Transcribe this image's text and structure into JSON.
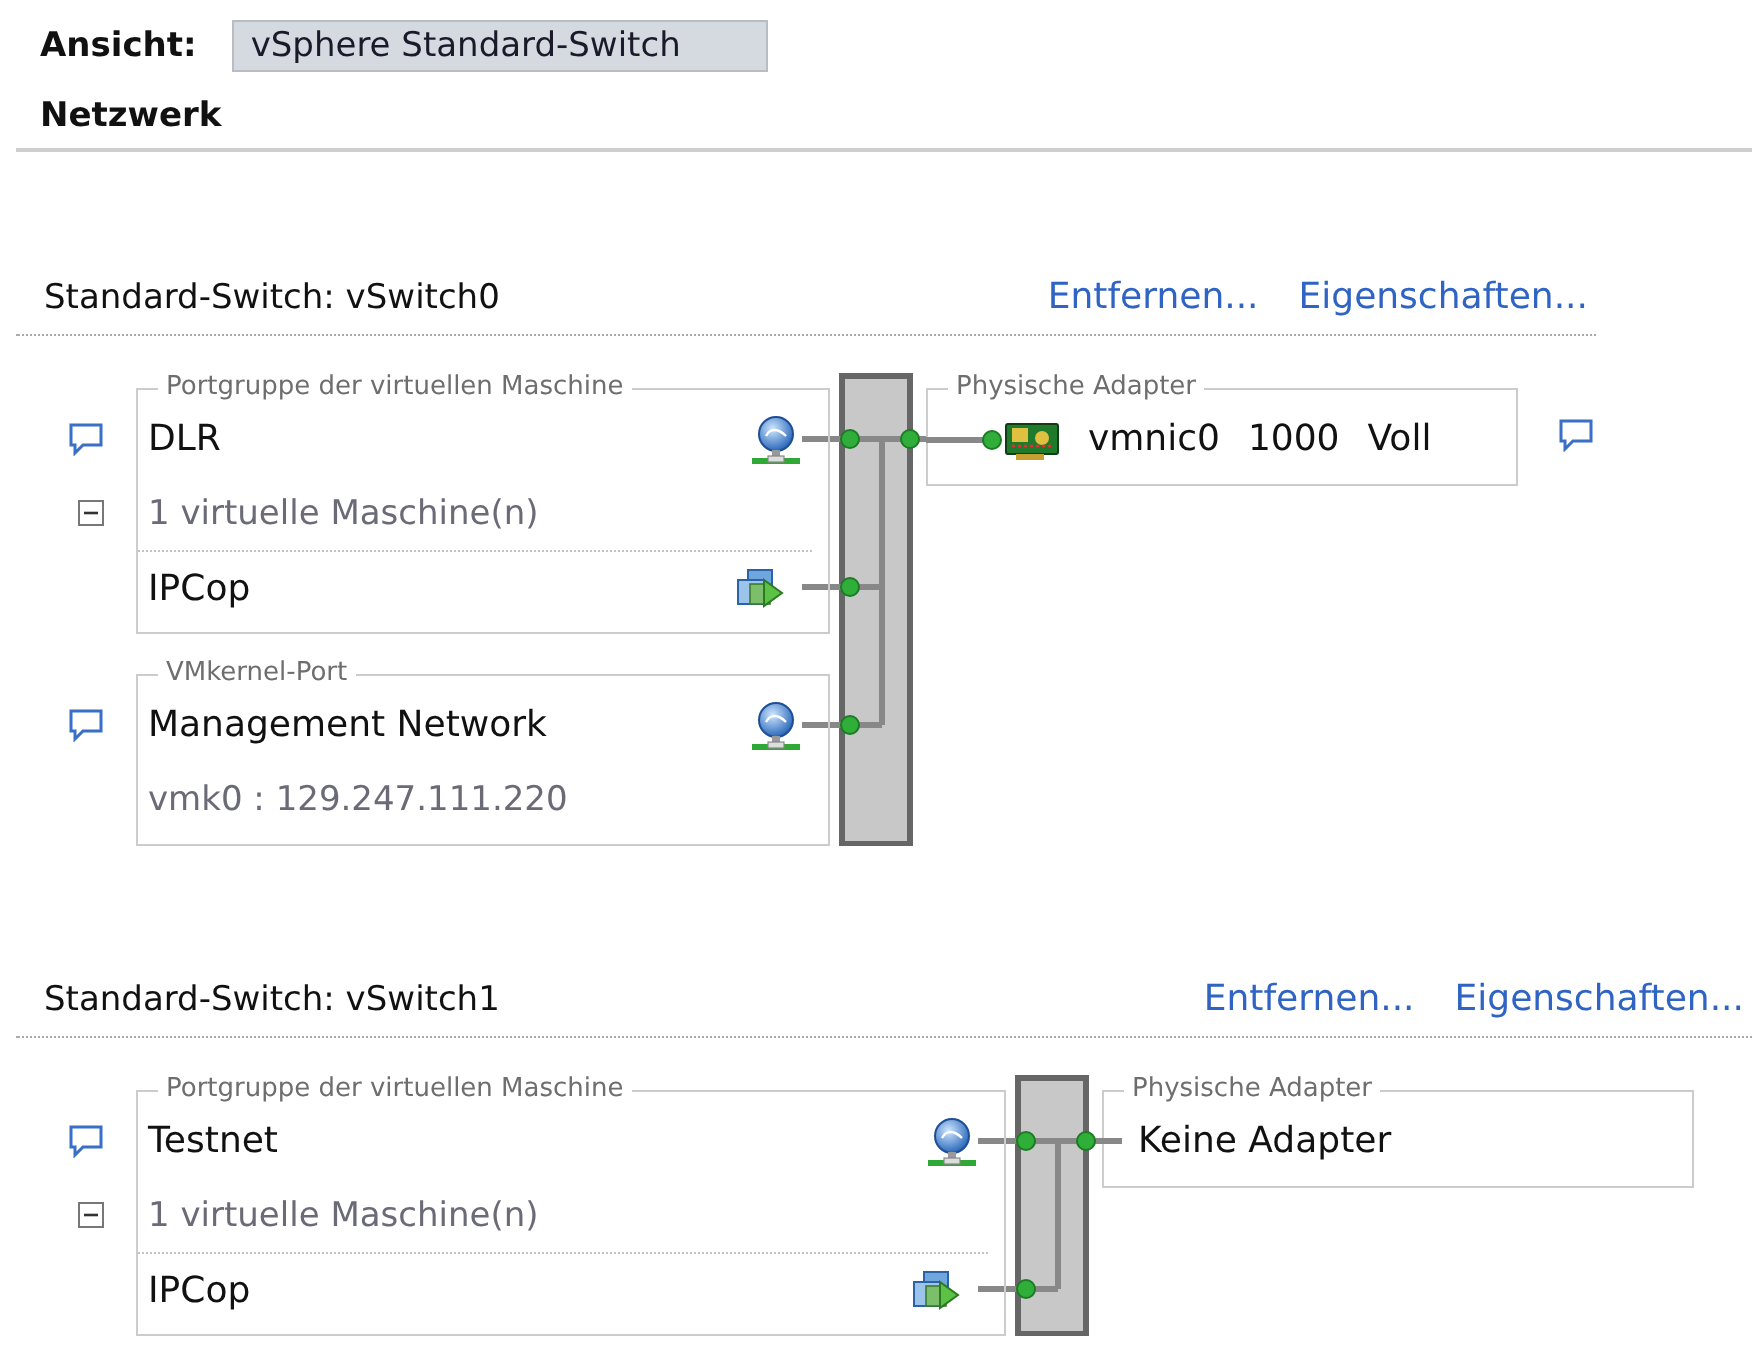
{
  "view": {
    "label": "Ansicht:",
    "value": "vSphere Standard-Switch"
  },
  "heading": "Netzwerk",
  "switches": [
    {
      "title": "Standard-Switch: vSwitch0",
      "actions": [
        "Entfernen...",
        "Eigenschaften..."
      ],
      "portgroups": [
        {
          "kind": "vm",
          "legend": "Portgruppe der virtuellen Maschine",
          "name": "DLR",
          "count": "1 virtuelle Maschine(n)",
          "expanded": true,
          "vms": [
            "IPCop"
          ]
        },
        {
          "kind": "vmkernel",
          "legend": "VMkernel-Port",
          "name": "Management Network",
          "address": "vmk0 : 129.247.111.220"
        }
      ],
      "adapters": {
        "legend": "Physische Adapter",
        "items": [
          {
            "kind": "nic",
            "name": "vmnic0",
            "speed": "1000",
            "duplex": "Voll"
          }
        ]
      }
    },
    {
      "title": "Standard-Switch: vSwitch1",
      "actions": [
        "Entfernen...",
        "Eigenschaften..."
      ],
      "portgroups": [
        {
          "kind": "vm",
          "legend": "Portgruppe der virtuellen Maschine",
          "name": "Testnet",
          "count": "1 virtuelle Maschine(n)",
          "expanded": true,
          "vms": [
            "IPCop"
          ]
        }
      ],
      "adapters": {
        "legend": "Physische Adapter",
        "items": [
          {
            "kind": "none",
            "text": "Keine Adapter"
          }
        ]
      }
    }
  ]
}
